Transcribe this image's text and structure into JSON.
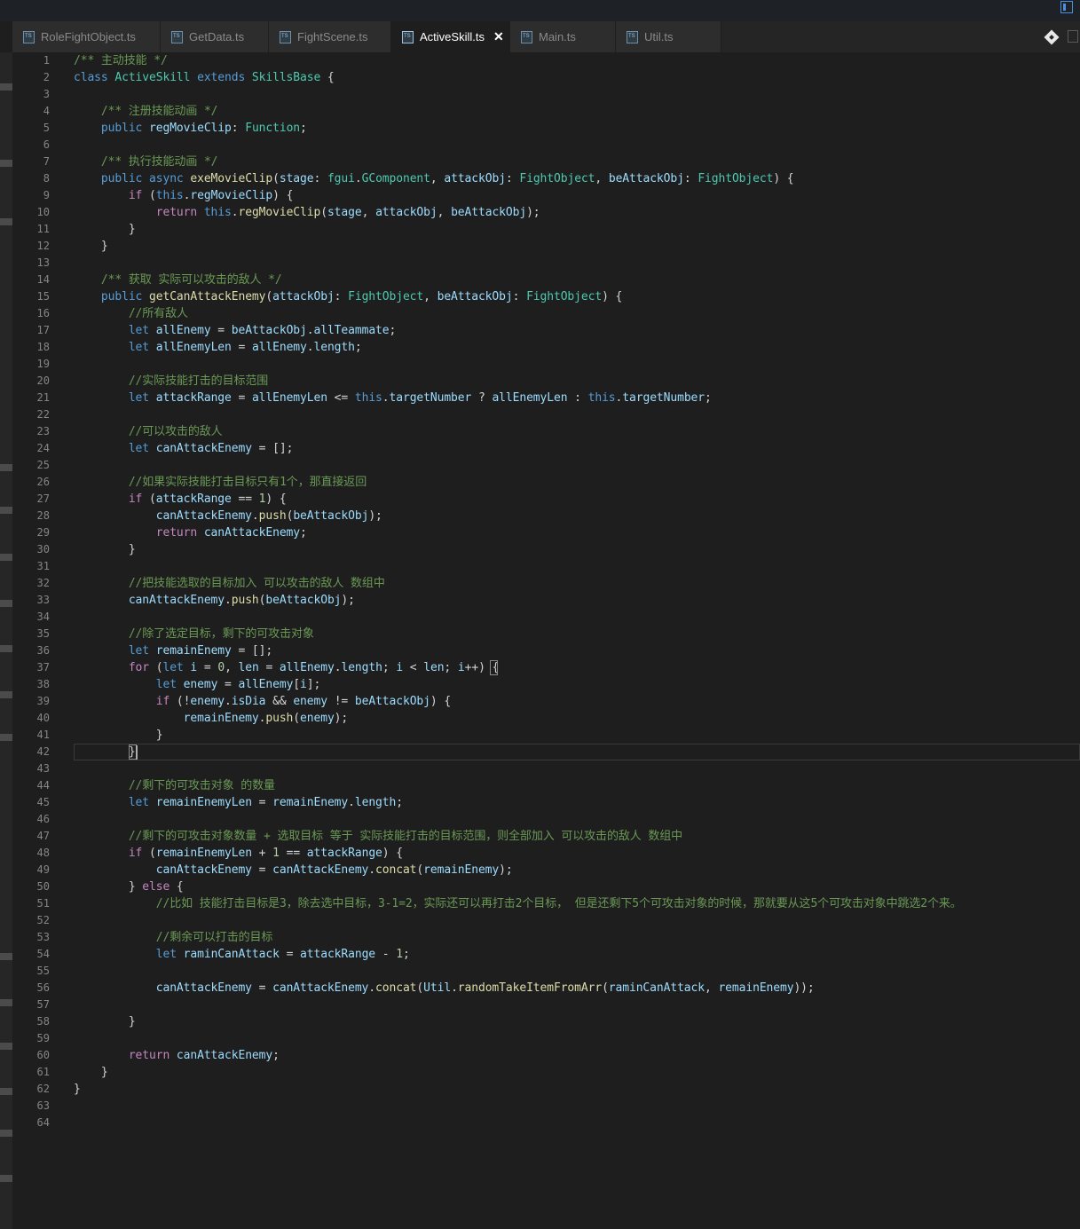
{
  "tabs": [
    {
      "label": "RoleFightObject.ts",
      "active": false
    },
    {
      "label": "GetData.ts",
      "active": false
    },
    {
      "label": "FightScene.ts",
      "active": false
    },
    {
      "label": "ActiveSkill.ts",
      "active": true
    },
    {
      "label": "Main.ts",
      "active": false
    },
    {
      "label": "Util.ts",
      "active": false
    }
  ],
  "close_glyph": "✕",
  "editor": {
    "current_line": 42,
    "lines": [
      [
        [
          "c",
          "/** 主动技能 */"
        ]
      ],
      [
        [
          "k",
          "class "
        ],
        [
          "t",
          "ActiveSkill"
        ],
        [
          "k",
          " extends "
        ],
        [
          "t",
          "SkillsBase"
        ],
        [
          "p",
          " {"
        ]
      ],
      [],
      [
        [
          "p",
          "    "
        ],
        [
          "c",
          "/** 注册技能动画 */"
        ]
      ],
      [
        [
          "p",
          "    "
        ],
        [
          "k",
          "public "
        ],
        [
          "v",
          "regMovieClip"
        ],
        [
          "p",
          ": "
        ],
        [
          "t",
          "Function"
        ],
        [
          "p",
          ";"
        ]
      ],
      [],
      [
        [
          "p",
          "    "
        ],
        [
          "c",
          "/** 执行技能动画 */"
        ]
      ],
      [
        [
          "p",
          "    "
        ],
        [
          "k",
          "public async "
        ],
        [
          "f",
          "exeMovieClip"
        ],
        [
          "p",
          "("
        ],
        [
          "v",
          "stage"
        ],
        [
          "p",
          ": "
        ],
        [
          "t",
          "fgui"
        ],
        [
          "p",
          "."
        ],
        [
          "t",
          "GComponent"
        ],
        [
          "p",
          ", "
        ],
        [
          "v",
          "attackObj"
        ],
        [
          "p",
          ": "
        ],
        [
          "t",
          "FightObject"
        ],
        [
          "p",
          ", "
        ],
        [
          "v",
          "beAttackObj"
        ],
        [
          "p",
          ": "
        ],
        [
          "t",
          "FightObject"
        ],
        [
          "p",
          ") {"
        ]
      ],
      [
        [
          "p",
          "        "
        ],
        [
          "kc",
          "if "
        ],
        [
          "p",
          "("
        ],
        [
          "k",
          "this"
        ],
        [
          "p",
          "."
        ],
        [
          "v",
          "regMovieClip"
        ],
        [
          "p",
          ") {"
        ]
      ],
      [
        [
          "p",
          "            "
        ],
        [
          "kc",
          "return "
        ],
        [
          "k",
          "this"
        ],
        [
          "p",
          "."
        ],
        [
          "f",
          "regMovieClip"
        ],
        [
          "p",
          "("
        ],
        [
          "v",
          "stage"
        ],
        [
          "p",
          ", "
        ],
        [
          "v",
          "attackObj"
        ],
        [
          "p",
          ", "
        ],
        [
          "v",
          "beAttackObj"
        ],
        [
          "p",
          ");"
        ]
      ],
      [
        [
          "p",
          "        }"
        ]
      ],
      [
        [
          "p",
          "    }"
        ]
      ],
      [],
      [
        [
          "p",
          "    "
        ],
        [
          "c",
          "/** 获取 实际可以攻击的敌人 */"
        ]
      ],
      [
        [
          "p",
          "    "
        ],
        [
          "k",
          "public "
        ],
        [
          "f",
          "getCanAttackEnemy"
        ],
        [
          "p",
          "("
        ],
        [
          "v",
          "attackObj"
        ],
        [
          "p",
          ": "
        ],
        [
          "t",
          "FightObject"
        ],
        [
          "p",
          ", "
        ],
        [
          "v",
          "beAttackObj"
        ],
        [
          "p",
          ": "
        ],
        [
          "t",
          "FightObject"
        ],
        [
          "p",
          ") {"
        ]
      ],
      [
        [
          "p",
          "        "
        ],
        [
          "c",
          "//所有敌人"
        ]
      ],
      [
        [
          "p",
          "        "
        ],
        [
          "k",
          "let "
        ],
        [
          "v",
          "allEnemy"
        ],
        [
          "p",
          " = "
        ],
        [
          "v",
          "beAttackObj"
        ],
        [
          "p",
          "."
        ],
        [
          "v",
          "allTeammate"
        ],
        [
          "p",
          ";"
        ]
      ],
      [
        [
          "p",
          "        "
        ],
        [
          "k",
          "let "
        ],
        [
          "v",
          "allEnemyLen"
        ],
        [
          "p",
          " = "
        ],
        [
          "v",
          "allEnemy"
        ],
        [
          "p",
          "."
        ],
        [
          "v",
          "length"
        ],
        [
          "p",
          ";"
        ]
      ],
      [],
      [
        [
          "p",
          "        "
        ],
        [
          "c",
          "//实际技能打击的目标范围"
        ]
      ],
      [
        [
          "p",
          "        "
        ],
        [
          "k",
          "let "
        ],
        [
          "v",
          "attackRange"
        ],
        [
          "p",
          " = "
        ],
        [
          "v",
          "allEnemyLen"
        ],
        [
          "p",
          " <= "
        ],
        [
          "k",
          "this"
        ],
        [
          "p",
          "."
        ],
        [
          "v",
          "targetNumber"
        ],
        [
          "p",
          " ? "
        ],
        [
          "v",
          "allEnemyLen"
        ],
        [
          "p",
          " : "
        ],
        [
          "k",
          "this"
        ],
        [
          "p",
          "."
        ],
        [
          "v",
          "targetNumber"
        ],
        [
          "p",
          ";"
        ]
      ],
      [],
      [
        [
          "p",
          "        "
        ],
        [
          "c",
          "//可以攻击的敌人"
        ]
      ],
      [
        [
          "p",
          "        "
        ],
        [
          "k",
          "let "
        ],
        [
          "v",
          "canAttackEnemy"
        ],
        [
          "p",
          " = [];"
        ]
      ],
      [],
      [
        [
          "p",
          "        "
        ],
        [
          "c",
          "//如果实际技能打击目标只有1个，那直接返回"
        ]
      ],
      [
        [
          "p",
          "        "
        ],
        [
          "kc",
          "if "
        ],
        [
          "p",
          "("
        ],
        [
          "v",
          "attackRange"
        ],
        [
          "p",
          " == "
        ],
        [
          "n",
          "1"
        ],
        [
          "p",
          ") {"
        ]
      ],
      [
        [
          "p",
          "            "
        ],
        [
          "v",
          "canAttackEnemy"
        ],
        [
          "p",
          "."
        ],
        [
          "f",
          "push"
        ],
        [
          "p",
          "("
        ],
        [
          "v",
          "beAttackObj"
        ],
        [
          "p",
          ");"
        ]
      ],
      [
        [
          "p",
          "            "
        ],
        [
          "kc",
          "return "
        ],
        [
          "v",
          "canAttackEnemy"
        ],
        [
          "p",
          ";"
        ]
      ],
      [
        [
          "p",
          "        }"
        ]
      ],
      [],
      [
        [
          "p",
          "        "
        ],
        [
          "c",
          "//把技能选取的目标加入 可以攻击的敌人 数组中"
        ]
      ],
      [
        [
          "p",
          "        "
        ],
        [
          "v",
          "canAttackEnemy"
        ],
        [
          "p",
          "."
        ],
        [
          "f",
          "push"
        ],
        [
          "p",
          "("
        ],
        [
          "v",
          "beAttackObj"
        ],
        [
          "p",
          ");"
        ]
      ],
      [],
      [
        [
          "p",
          "        "
        ],
        [
          "c",
          "//除了选定目标，剩下的可攻击对象"
        ]
      ],
      [
        [
          "p",
          "        "
        ],
        [
          "k",
          "let "
        ],
        [
          "v",
          "remainEnemy"
        ],
        [
          "p",
          " = [];"
        ]
      ],
      [
        [
          "p",
          "        "
        ],
        [
          "kc",
          "for "
        ],
        [
          "p",
          "("
        ],
        [
          "k",
          "let "
        ],
        [
          "v",
          "i"
        ],
        [
          "p",
          " = "
        ],
        [
          "n",
          "0"
        ],
        [
          "p",
          ", "
        ],
        [
          "v",
          "len"
        ],
        [
          "p",
          " = "
        ],
        [
          "v",
          "allEnemy"
        ],
        [
          "p",
          "."
        ],
        [
          "v",
          "length"
        ],
        [
          "p",
          "; "
        ],
        [
          "v",
          "i"
        ],
        [
          "p",
          " < "
        ],
        [
          "v",
          "len"
        ],
        [
          "p",
          "; "
        ],
        [
          "v",
          "i"
        ],
        [
          "p",
          "++) {"
        ]
      ],
      [
        [
          "p",
          "            "
        ],
        [
          "k",
          "let "
        ],
        [
          "v",
          "enemy"
        ],
        [
          "p",
          " = "
        ],
        [
          "v",
          "allEnemy"
        ],
        [
          "p",
          "["
        ],
        [
          "v",
          "i"
        ],
        [
          "p",
          "];"
        ]
      ],
      [
        [
          "p",
          "            "
        ],
        [
          "kc",
          "if "
        ],
        [
          "p",
          "(!"
        ],
        [
          "v",
          "enemy"
        ],
        [
          "p",
          "."
        ],
        [
          "v",
          "isDia"
        ],
        [
          "p",
          " && "
        ],
        [
          "v",
          "enemy"
        ],
        [
          "p",
          " != "
        ],
        [
          "v",
          "beAttackObj"
        ],
        [
          "p",
          ") {"
        ]
      ],
      [
        [
          "p",
          "                "
        ],
        [
          "v",
          "remainEnemy"
        ],
        [
          "p",
          "."
        ],
        [
          "f",
          "push"
        ],
        [
          "p",
          "("
        ],
        [
          "v",
          "enemy"
        ],
        [
          "p",
          ");"
        ]
      ],
      [
        [
          "p",
          "            }"
        ]
      ],
      [
        [
          "p",
          "        }"
        ]
      ],
      [],
      [
        [
          "p",
          "        "
        ],
        [
          "c",
          "//剩下的可攻击对象 的数量"
        ]
      ],
      [
        [
          "p",
          "        "
        ],
        [
          "k",
          "let "
        ],
        [
          "v",
          "remainEnemyLen"
        ],
        [
          "p",
          " = "
        ],
        [
          "v",
          "remainEnemy"
        ],
        [
          "p",
          "."
        ],
        [
          "v",
          "length"
        ],
        [
          "p",
          ";"
        ]
      ],
      [],
      [
        [
          "p",
          "        "
        ],
        [
          "c",
          "//剩下的可攻击对象数量 + 选取目标 等于 实际技能打击的目标范围，则全部加入 可以攻击的敌人 数组中"
        ]
      ],
      [
        [
          "p",
          "        "
        ],
        [
          "kc",
          "if "
        ],
        [
          "p",
          "("
        ],
        [
          "v",
          "remainEnemyLen"
        ],
        [
          "p",
          " + "
        ],
        [
          "n",
          "1"
        ],
        [
          "p",
          " == "
        ],
        [
          "v",
          "attackRange"
        ],
        [
          "p",
          ") {"
        ]
      ],
      [
        [
          "p",
          "            "
        ],
        [
          "v",
          "canAttackEnemy"
        ],
        [
          "p",
          " = "
        ],
        [
          "v",
          "canAttackEnemy"
        ],
        [
          "p",
          "."
        ],
        [
          "f",
          "concat"
        ],
        [
          "p",
          "("
        ],
        [
          "v",
          "remainEnemy"
        ],
        [
          "p",
          ");"
        ]
      ],
      [
        [
          "p",
          "        } "
        ],
        [
          "kc",
          "else"
        ],
        [
          "p",
          " {"
        ]
      ],
      [
        [
          "p",
          "            "
        ],
        [
          "c",
          "//比如 技能打击目标是3，除去选中目标，3-1=2，实际还可以再打击2个目标， 但是还剩下5个可攻击对象的时候，那就要从这5个可攻击对象中跳选2个来。"
        ]
      ],
      [],
      [
        [
          "p",
          "            "
        ],
        [
          "c",
          "//剩余可以打击的目标"
        ]
      ],
      [
        [
          "p",
          "            "
        ],
        [
          "k",
          "let "
        ],
        [
          "v",
          "raminCanAttack"
        ],
        [
          "p",
          " = "
        ],
        [
          "v",
          "attackRange"
        ],
        [
          "p",
          " - "
        ],
        [
          "n",
          "1"
        ],
        [
          "p",
          ";"
        ]
      ],
      [],
      [
        [
          "p",
          "            "
        ],
        [
          "v",
          "canAttackEnemy"
        ],
        [
          "p",
          " = "
        ],
        [
          "v",
          "canAttackEnemy"
        ],
        [
          "p",
          "."
        ],
        [
          "f",
          "concat"
        ],
        [
          "p",
          "("
        ],
        [
          "v",
          "Util"
        ],
        [
          "p",
          "."
        ],
        [
          "f",
          "randomTakeItemFromArr"
        ],
        [
          "p",
          "("
        ],
        [
          "v",
          "raminCanAttack"
        ],
        [
          "p",
          ", "
        ],
        [
          "v",
          "remainEnemy"
        ],
        [
          "p",
          "));"
        ]
      ],
      [],
      [
        [
          "p",
          "        }"
        ]
      ],
      [],
      [
        [
          "p",
          "        "
        ],
        [
          "kc",
          "return "
        ],
        [
          "v",
          "canAttackEnemy"
        ],
        [
          "p",
          ";"
        ]
      ],
      [
        [
          "p",
          "    }"
        ]
      ],
      [
        [
          "p",
          "}"
        ]
      ],
      [],
      []
    ]
  }
}
